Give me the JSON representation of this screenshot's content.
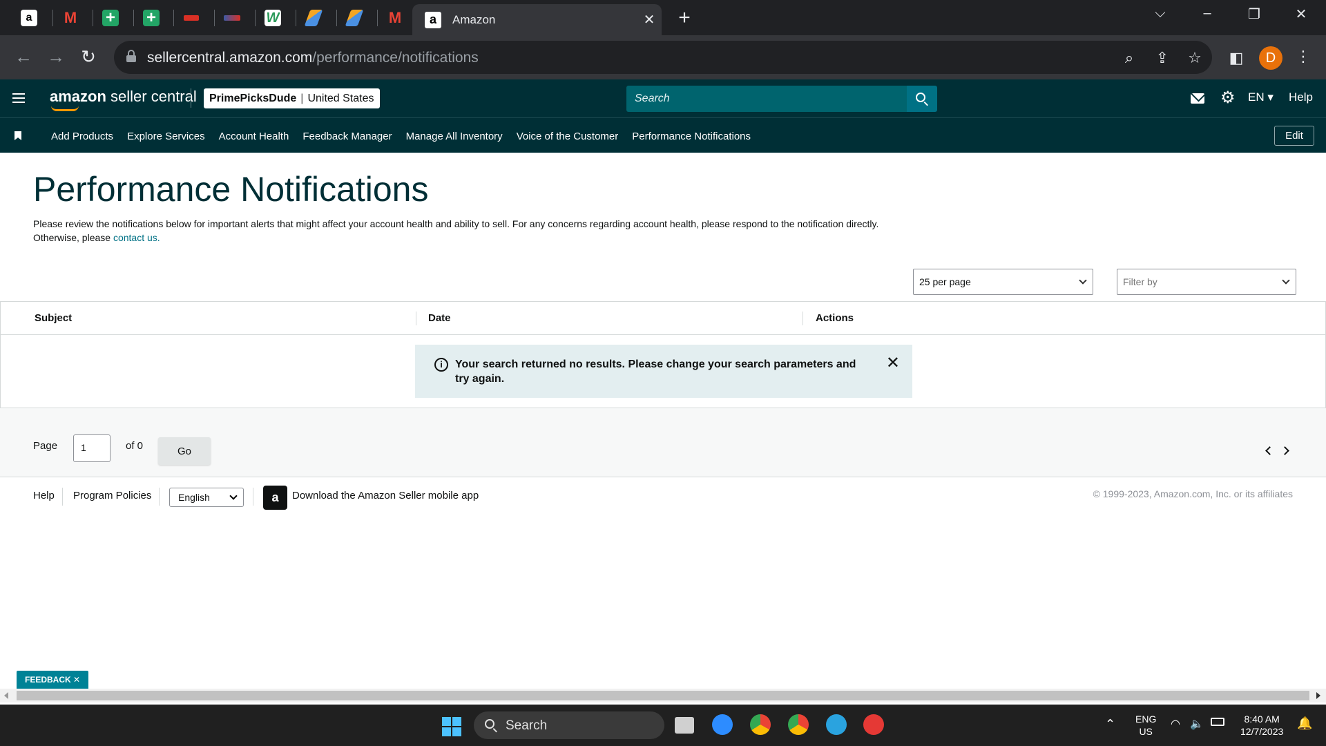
{
  "browser": {
    "active_tab_title": "Amazon",
    "url_host": "sellercentral.amazon.com",
    "url_path": "/performance/notifications",
    "profile_initial": "D",
    "pinned_tabs": [
      "a",
      "M",
      "+",
      "+",
      "",
      "",
      "W",
      "",
      "",
      "M"
    ]
  },
  "header": {
    "logo_brand": "amazon",
    "logo_suffix": " seller central",
    "store_name": "PrimePicksDude",
    "store_separator": "|",
    "store_region": "United States",
    "search_placeholder": "Search",
    "language": "EN",
    "help": "Help"
  },
  "nav": {
    "links": [
      "Add Products",
      "Explore Services",
      "Account Health",
      "Feedback Manager",
      "Manage All Inventory",
      "Voice of the Customer",
      "Performance Notifications"
    ],
    "edit": "Edit"
  },
  "page": {
    "title": "Performance Notifications",
    "description": "Please review the notifications below for important alerts that might affect your account health and ability to sell. For any concerns regarding account health, please respond to the notification directly. Otherwise, please ",
    "contact_link": "contact us.",
    "per_page": "25 per page",
    "filter_placeholder": "Filter by"
  },
  "table": {
    "columns": [
      "Subject",
      "Date",
      "Actions"
    ],
    "empty_message": "Your search returned no results. Please change your search parameters and try again."
  },
  "pager": {
    "page_label": "Page",
    "page_value": "1",
    "of_label": "of 0",
    "go": "Go"
  },
  "footer": {
    "help": "Help",
    "program_policies": "Program Policies",
    "language": "English",
    "download_app": "Download the Amazon Seller mobile app",
    "copyright": "© 1999-2023, Amazon.com, Inc. or its affiliates"
  },
  "feedback": "FEEDBACK",
  "taskbar": {
    "search": "Search",
    "lang_top": "ENG",
    "lang_bottom": "US",
    "time": "8:40 AM",
    "date": "12/7/2023"
  },
  "colors": {
    "header_bg": "#002f36",
    "accent": "#007185",
    "alert_bg": "#e3eef0"
  }
}
